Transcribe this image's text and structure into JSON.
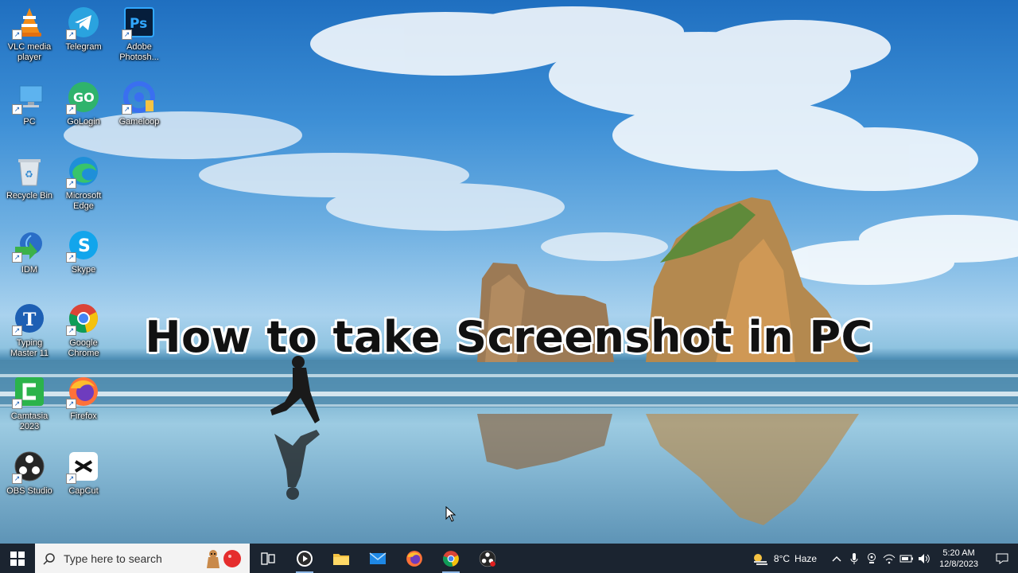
{
  "desktop": {
    "icons": [
      {
        "label": "VLC media player",
        "icon": "vlc-icon"
      },
      {
        "label": "Telegram",
        "icon": "telegram-icon"
      },
      {
        "label": "Adobe Photosh...",
        "icon": "photoshop-icon"
      },
      {
        "label": "PC",
        "icon": "pc-icon"
      },
      {
        "label": "GoLogin",
        "icon": "gologin-icon"
      },
      {
        "label": "Gameloop",
        "icon": "gameloop-icon"
      },
      {
        "label": "Recycle Bin",
        "icon": "recycle-bin-icon"
      },
      {
        "label": "Microsoft Edge",
        "icon": "edge-icon"
      },
      {
        "label": "IDM",
        "icon": "idm-icon"
      },
      {
        "label": "Skype",
        "icon": "skype-icon"
      },
      {
        "label": "Typing Master 11",
        "icon": "typing-master-icon"
      },
      {
        "label": "Google Chrome",
        "icon": "chrome-icon"
      },
      {
        "label": "Camtasia 2023",
        "icon": "camtasia-icon"
      },
      {
        "label": "Firefox",
        "icon": "firefox-icon"
      },
      {
        "label": "OBS Studio",
        "icon": "obs-icon"
      },
      {
        "label": "CapCut",
        "icon": "capcut-icon"
      }
    ]
  },
  "caption": "How to take Screenshot in PC",
  "taskbar": {
    "search_placeholder": "Type here to search",
    "pinned": [
      "task-view-icon",
      "media-player-icon",
      "file-explorer-icon",
      "mail-icon",
      "firefox-icon",
      "chrome-icon",
      "obs-icon"
    ],
    "weather": {
      "temp": "8°C",
      "condition": "Haze"
    },
    "clock": {
      "time": "5:20 AM",
      "date": "12/8/2023"
    }
  },
  "colors": {
    "taskbar": "#1b2430",
    "search_box": "#f3f3f3",
    "accent": "#8fb8e6"
  }
}
